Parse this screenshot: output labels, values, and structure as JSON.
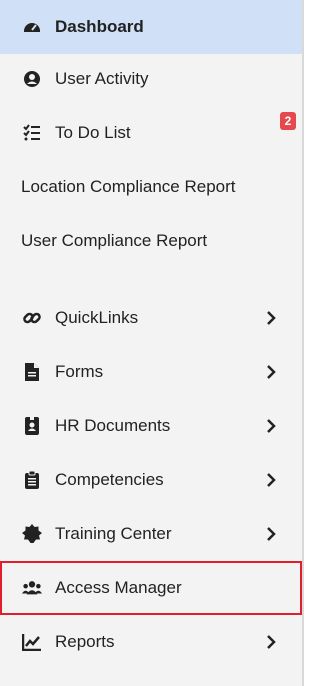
{
  "sidebar": {
    "items": [
      {
        "label": "Dashboard",
        "icon": "dashboard-icon"
      },
      {
        "label": "User Activity",
        "icon": "user-circle-icon"
      },
      {
        "label": "To Do List",
        "icon": "checklist-icon"
      },
      {
        "label": "Location Compliance Report"
      },
      {
        "label": "User Compliance Report"
      },
      {
        "label": "QuickLinks",
        "icon": "link-icon"
      },
      {
        "label": "Forms",
        "icon": "file-icon"
      },
      {
        "label": "HR Documents",
        "icon": "badge-icon"
      },
      {
        "label": "Competencies",
        "icon": "clipboard-icon"
      },
      {
        "label": "Training Center",
        "icon": "certificate-icon"
      },
      {
        "label": "Access Manager",
        "icon": "users-icon"
      },
      {
        "label": "Reports",
        "icon": "chart-line-icon"
      }
    ],
    "todo_badge": "2"
  },
  "colors": {
    "active_bg": "#cfe0f7",
    "highlight": "#e11d2e",
    "badge": "#e5484d"
  }
}
